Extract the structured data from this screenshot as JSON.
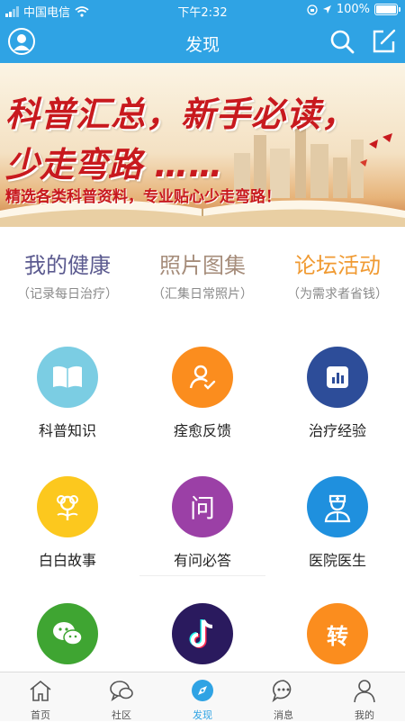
{
  "status": {
    "carrier": "中国电信",
    "time": "下午2:32",
    "battery": "100%"
  },
  "header": {
    "title": "发现"
  },
  "banner": {
    "line1": "科普汇总，新手必读，",
    "line2": "少走弯路 ……",
    "subtitle": "精选各类科普资料，专业贴心少走弯路！"
  },
  "quick_links": [
    {
      "title": "我的健康",
      "desc": "（记录每日治疗）",
      "color": "#5b5a8f"
    },
    {
      "title": "照片图集",
      "desc": "（汇集日常照片）",
      "color": "#a68d7b"
    },
    {
      "title": "论坛活动",
      "desc": "（为需求者省钱）",
      "color": "#f09a32"
    }
  ],
  "grid": [
    {
      "label": "科普知识",
      "icon": "book-icon",
      "color": "#7bcde3"
    },
    {
      "label": "痊愈反馈",
      "icon": "user-check-icon",
      "color": "#fb8d1e"
    },
    {
      "label": "治疗经验",
      "icon": "chart-icon",
      "color": "#2d4d99"
    },
    {
      "label": "白白故事",
      "icon": "flower-icon",
      "color": "#fcc81e"
    },
    {
      "label": "有问必答",
      "icon": "question-icon",
      "color": "#9b40a6",
      "glyph": "问"
    },
    {
      "label": "医院医生",
      "icon": "doctor-icon",
      "color": "#1f90de"
    },
    {
      "label": "",
      "icon": "wechat-icon",
      "color": "#3fa532"
    },
    {
      "label": "",
      "icon": "tiktok-icon",
      "color": "#2a1a5e"
    },
    {
      "label": "",
      "icon": "transfer-icon",
      "color": "#fb8d1e",
      "glyph": "转"
    }
  ],
  "tabs": [
    {
      "label": "首页",
      "icon": "home-icon",
      "active": false
    },
    {
      "label": "社区",
      "icon": "community-icon",
      "active": false
    },
    {
      "label": "发现",
      "icon": "compass-icon",
      "active": true
    },
    {
      "label": "消息",
      "icon": "message-icon",
      "active": false
    },
    {
      "label": "我的",
      "icon": "profile-icon",
      "active": false
    }
  ],
  "colors": {
    "primary": "#2fa3e4",
    "banner_text": "#c8191e"
  }
}
